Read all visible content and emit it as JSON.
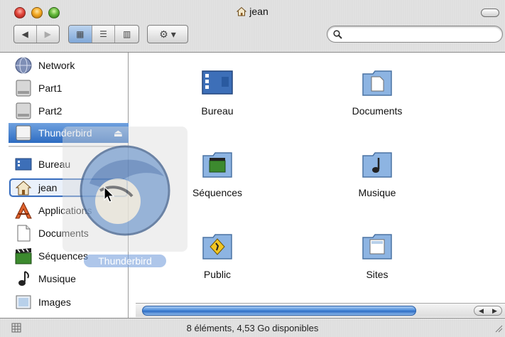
{
  "window": {
    "title": "jean",
    "title_icon": "home-icon"
  },
  "toolbar": {
    "back_label": "◀",
    "forward_label": "▶",
    "view_icon_label": "▦",
    "view_list_label": "☰",
    "view_column_label": "▥",
    "action_label": "⚙ ▾",
    "search_placeholder": ""
  },
  "sidebar": {
    "devices": [
      {
        "label": "Network",
        "icon": "network-globe-icon"
      },
      {
        "label": "Part1",
        "icon": "hard-drive-icon"
      },
      {
        "label": "Part2",
        "icon": "hard-drive-icon"
      },
      {
        "label": "Thunderbird",
        "icon": "disk-image-icon",
        "selected": true,
        "eject": "⏏"
      }
    ],
    "places": [
      {
        "label": "Bureau",
        "icon": "desktop-folder-icon"
      },
      {
        "label": "jean",
        "icon": "home-icon",
        "focused": true
      },
      {
        "label": "Applications",
        "icon": "applications-icon"
      },
      {
        "label": "Documents",
        "icon": "document-icon"
      },
      {
        "label": "Séquences",
        "icon": "movie-clapper-icon"
      },
      {
        "label": "Musique",
        "icon": "music-note-icon"
      },
      {
        "label": "Images",
        "icon": "picture-icon"
      }
    ]
  },
  "content": {
    "items": [
      {
        "label": "Bureau",
        "icon": "desktop-folder-icon"
      },
      {
        "label": "Documents",
        "icon": "documents-folder-icon"
      },
      {
        "label": "Séquences",
        "icon": "movies-folder-icon"
      },
      {
        "label": "Musique",
        "icon": "music-folder-icon"
      },
      {
        "label": "Public",
        "icon": "public-folder-icon"
      },
      {
        "label": "Sites",
        "icon": "sites-folder-icon"
      }
    ]
  },
  "drag": {
    "label": "Thunderbird"
  },
  "status": {
    "text": "8 éléments, 4,53 Go disponibles"
  },
  "colors": {
    "selection": "#2d6cc2",
    "folder_blue": "#8db4e2",
    "scroll_thumb": "#4f8ddb"
  }
}
